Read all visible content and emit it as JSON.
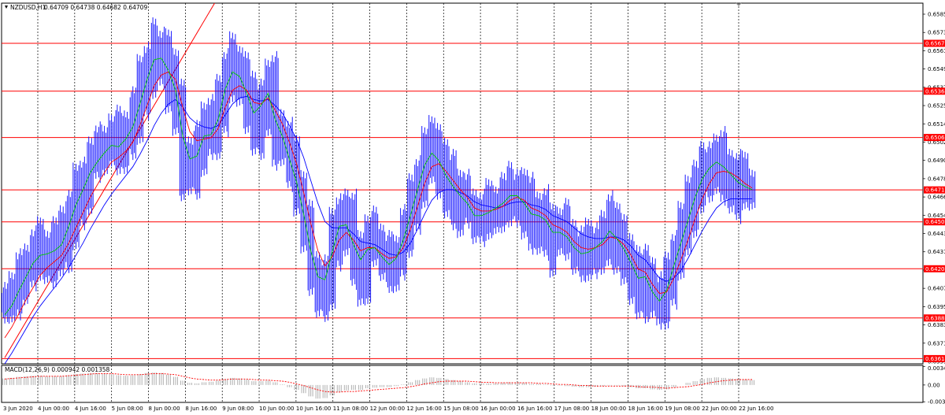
{
  "header": {
    "symbol": "NZDUSD,H1",
    "ohlc": "0.64709 0.64738 0.64682 0.64709"
  },
  "macd_header": {
    "label": "MACD(12,26,9) 0.000942 0.001358"
  },
  "colors": {
    "background": "#ffffff",
    "price_bars": "#0000ff",
    "ma_fast": "#00c800",
    "ma_mid": "#ff0000",
    "ma_slow": "#0000ff",
    "level_line": "#ff0000",
    "trend_line": "#ff0000",
    "grid": "#000000"
  },
  "chart_data": [
    {
      "type": "line",
      "subtype": "candlestick-bars-with-moving-averages",
      "symbol": "NZDUSD",
      "timeframe": "H1",
      "y_ticks": [
        "0.65855",
        "0.65735",
        "0.65615",
        "0.65495",
        "0.65375",
        "0.65255",
        "0.65140",
        "0.65020",
        "0.64900",
        "0.64780",
        "0.64665",
        "0.64545",
        "0.64430",
        "0.64310",
        "0.64190",
        "0.64070",
        "0.63950",
        "0.63830",
        "0.63710",
        "0.63590"
      ],
      "ylim": [
        0.6358,
        0.6594
      ],
      "x_ticks": [
        "3 Jun 2020",
        "4 Jun 00:00",
        "4 Jun 16:00",
        "5 Jun 08:00",
        "8 Jun 00:00",
        "8 Jun 16:00",
        "9 Jun 08:00",
        "10 Jun 00:00",
        "10 Jun 16:00",
        "11 Jun 08:00",
        "12 Jun 00:00",
        "12 Jun 16:00",
        "15 Jun 08:00",
        "16 Jun 00:00",
        "16 Jun 16:00",
        "17 Jun 08:00",
        "18 Jun 00:00",
        "18 Jun 16:00",
        "19 Jun 08:00",
        "22 Jun 00:00",
        "22 Jun 16:00"
      ],
      "horizontal_levels": [
        "0.65677",
        "0.65364",
        "0.65061",
        "0.64718",
        "0.64509",
        "0.64202",
        "0.63880",
        "0.63614"
      ],
      "series": [
        {
          "role": "close",
          "values": [
            0.6398,
            0.6402,
            0.6412,
            0.6423,
            0.643,
            0.6432,
            0.6428,
            0.6435,
            0.644,
            0.6455,
            0.647,
            0.648,
            0.649,
            0.6495,
            0.65,
            0.6505,
            0.6498,
            0.651,
            0.652,
            0.6538,
            0.6552,
            0.6565,
            0.656,
            0.6545,
            0.653,
            0.649,
            0.648,
            0.6495,
            0.6515,
            0.6508,
            0.6525,
            0.6548,
            0.6555,
            0.6545,
            0.653,
            0.6515,
            0.653,
            0.654,
            0.651,
            0.65,
            0.6485,
            0.647,
            0.6445,
            0.642,
            0.6405,
            0.6412,
            0.644,
            0.6455,
            0.645,
            0.643,
            0.642,
            0.6438,
            0.6435,
            0.6425,
            0.642,
            0.643,
            0.6445,
            0.6462,
            0.648,
            0.6495,
            0.65,
            0.6488,
            0.6475,
            0.647,
            0.6465,
            0.646,
            0.645,
            0.6455,
            0.6458,
            0.6462,
            0.6465,
            0.647,
            0.6468,
            0.646,
            0.6452,
            0.6455,
            0.645,
            0.644,
            0.6445,
            0.644,
            0.643,
            0.6428,
            0.6432,
            0.6435,
            0.644,
            0.6448,
            0.6438,
            0.643,
            0.642,
            0.641,
            0.6415,
            0.64,
            0.6395,
            0.641,
            0.643,
            0.6445,
            0.646,
            0.6475,
            0.6485,
            0.649,
            0.6492,
            0.6485,
            0.648,
            0.6475,
            0.6472,
            0.6471
          ]
        },
        {
          "role": "ma_fast",
          "values": [
            0.639,
            0.6396,
            0.6406,
            0.6415,
            0.6424,
            0.6429,
            0.643,
            0.6432,
            0.6436,
            0.6448,
            0.6462,
            0.6472,
            0.6483,
            0.649,
            0.6496,
            0.6501,
            0.65,
            0.6505,
            0.6513,
            0.6528,
            0.6544,
            0.6557,
            0.6558,
            0.655,
            0.6537,
            0.6507,
            0.6492,
            0.6494,
            0.6507,
            0.6508,
            0.6518,
            0.6538,
            0.6549,
            0.6546,
            0.6535,
            0.6522,
            0.6527,
            0.6535,
            0.6518,
            0.6507,
            0.6492,
            0.6477,
            0.6456,
            0.6432,
            0.6415,
            0.6413,
            0.6431,
            0.6448,
            0.6449,
            0.6436,
            0.6426,
            0.6433,
            0.6434,
            0.6428,
            0.6423,
            0.6427,
            0.6439,
            0.6455,
            0.6472,
            0.6488,
            0.6496,
            0.6491,
            0.6481,
            0.6474,
            0.6468,
            0.6463,
            0.6455,
            0.6455,
            0.6457,
            0.646,
            0.6463,
            0.6468,
            0.6468,
            0.6463,
            0.6456,
            0.6455,
            0.6452,
            0.6444,
            0.6444,
            0.6441,
            0.6434,
            0.643,
            0.6431,
            0.6434,
            0.6438,
            0.6445,
            0.644,
            0.6433,
            0.6424,
            0.6414,
            0.6415,
            0.6405,
            0.6399,
            0.6406,
            0.6422,
            0.6437,
            0.6452,
            0.6467,
            0.6479,
            0.6486,
            0.649,
            0.6487,
            0.6482,
            0.6477,
            0.6474,
            0.6472
          ]
        },
        {
          "role": "ma_mid",
          "values": [
            0.6375,
            0.6382,
            0.6391,
            0.64,
            0.6408,
            0.6416,
            0.6421,
            0.6425,
            0.6429,
            0.6437,
            0.6447,
            0.6457,
            0.6467,
            0.6475,
            0.6483,
            0.649,
            0.6493,
            0.6497,
            0.6503,
            0.6514,
            0.6527,
            0.654,
            0.6547,
            0.6549,
            0.6544,
            0.6526,
            0.651,
            0.6504,
            0.6505,
            0.6506,
            0.6512,
            0.6526,
            0.6537,
            0.654,
            0.6537,
            0.6529,
            0.6528,
            0.6532,
            0.6524,
            0.6515,
            0.6503,
            0.6489,
            0.647,
            0.645,
            0.6432,
            0.6422,
            0.6428,
            0.6439,
            0.6444,
            0.6439,
            0.6432,
            0.6434,
            0.6434,
            0.643,
            0.6427,
            0.6428,
            0.6434,
            0.6446,
            0.6461,
            0.6476,
            0.6487,
            0.6489,
            0.6484,
            0.6478,
            0.6472,
            0.6467,
            0.646,
            0.6458,
            0.6458,
            0.6459,
            0.6461,
            0.6465,
            0.6467,
            0.6465,
            0.646,
            0.6458,
            0.6455,
            0.6449,
            0.6447,
            0.6444,
            0.6438,
            0.6434,
            0.6433,
            0.6434,
            0.6436,
            0.6441,
            0.644,
            0.6436,
            0.6429,
            0.642,
            0.6418,
            0.641,
            0.6404,
            0.6405,
            0.6414,
            0.6426,
            0.6439,
            0.6453,
            0.6466,
            0.6476,
            0.6483,
            0.6484,
            0.6483,
            0.648,
            0.6476,
            0.6473
          ]
        },
        {
          "role": "ma_slow",
          "values": [
            0.6358,
            0.6365,
            0.6373,
            0.6381,
            0.6389,
            0.6396,
            0.6402,
            0.6408,
            0.6414,
            0.6421,
            0.6429,
            0.6437,
            0.6446,
            0.6454,
            0.6462,
            0.6469,
            0.6475,
            0.6481,
            0.6487,
            0.6495,
            0.6504,
            0.6514,
            0.6522,
            0.6528,
            0.6531,
            0.6526,
            0.6519,
            0.6515,
            0.6513,
            0.6512,
            0.6514,
            0.6521,
            0.6528,
            0.6532,
            0.6533,
            0.6531,
            0.653,
            0.6531,
            0.6527,
            0.6522,
            0.6514,
            0.6505,
            0.6493,
            0.6478,
            0.6463,
            0.6451,
            0.6447,
            0.6447,
            0.6447,
            0.6443,
            0.6438,
            0.6437,
            0.6436,
            0.6433,
            0.643,
            0.6429,
            0.6431,
            0.6437,
            0.6446,
            0.6456,
            0.6465,
            0.647,
            0.6472,
            0.6472,
            0.647,
            0.6468,
            0.6464,
            0.6462,
            0.6461,
            0.646,
            0.6461,
            0.6463,
            0.6464,
            0.6464,
            0.6462,
            0.6461,
            0.6459,
            0.6455,
            0.6453,
            0.6451,
            0.6447,
            0.6443,
            0.6441,
            0.644,
            0.644,
            0.6441,
            0.6441,
            0.6439,
            0.6435,
            0.6429,
            0.6426,
            0.642,
            0.6414,
            0.6412,
            0.6414,
            0.6419,
            0.6427,
            0.6436,
            0.6445,
            0.6453,
            0.646,
            0.6464,
            0.6466,
            0.6466,
            0.6466,
            0.6466
          ]
        }
      ],
      "trend_line": {
        "from": [
          0,
          0.6362
        ],
        "to": [
          30,
          0.6598
        ]
      }
    },
    {
      "type": "bar",
      "subtype": "macd-histogram-with-signal",
      "name": "MACD(12,26,9)",
      "y_ticks": [
        "0.003415",
        "0.00",
        "-0.00308"
      ],
      "ylim": [
        -0.0032,
        0.0036
      ],
      "histogram": [
        0.0012,
        0.0013,
        0.0015,
        0.0016,
        0.0017,
        0.0017,
        0.0016,
        0.0016,
        0.0016,
        0.0018,
        0.002,
        0.0021,
        0.0022,
        0.0022,
        0.0021,
        0.002,
        0.0018,
        0.0017,
        0.0018,
        0.002,
        0.0022,
        0.0023,
        0.0022,
        0.0019,
        0.0015,
        0.0008,
        0.0004,
        0.0003,
        0.0005,
        0.0006,
        0.0008,
        0.0011,
        0.0013,
        0.0012,
        0.001,
        0.0007,
        0.0007,
        0.0008,
        0.0005,
        0.0001,
        -0.0004,
        -0.0009,
        -0.0015,
        -0.0021,
        -0.0025,
        -0.0024,
        -0.0019,
        -0.0013,
        -0.001,
        -0.0009,
        -0.0009,
        -0.0006,
        -0.0005,
        -0.0004,
        -0.0004,
        -0.0002,
        0.0001,
        0.0005,
        0.0009,
        0.0012,
        0.0014,
        0.0013,
        0.0011,
        0.0009,
        0.0007,
        0.0005,
        0.0003,
        0.0003,
        0.0003,
        0.0003,
        0.0004,
        0.0005,
        0.0005,
        0.0004,
        0.0002,
        0.0002,
        0.0001,
        -0.0001,
        -0.0001,
        -0.0002,
        -0.0003,
        -0.0004,
        -0.0004,
        -0.0003,
        -0.0002,
        -0.0001,
        -0.0001,
        -0.0002,
        -0.0004,
        -0.0006,
        -0.0006,
        -0.0008,
        -0.0009,
        -0.0008,
        -0.0004,
        0.0,
        0.0004,
        0.0007,
        0.0011,
        0.0013,
        0.0014,
        0.0013,
        0.0012,
        0.0011,
        0.001,
        0.0009
      ],
      "signal": [
        0.0011,
        0.0012,
        0.0013,
        0.0014,
        0.0015,
        0.0016,
        0.0016,
        0.0016,
        0.0016,
        0.0017,
        0.0018,
        0.0019,
        0.002,
        0.0021,
        0.0021,
        0.0021,
        0.002,
        0.0019,
        0.0019,
        0.0019,
        0.002,
        0.0021,
        0.0021,
        0.002,
        0.0019,
        0.0016,
        0.0013,
        0.0011,
        0.001,
        0.0009,
        0.0009,
        0.001,
        0.0011,
        0.0011,
        0.0011,
        0.001,
        0.0009,
        0.0009,
        0.0008,
        0.0007,
        0.0005,
        0.0002,
        -0.0001,
        -0.0005,
        -0.0009,
        -0.0012,
        -0.0013,
        -0.0013,
        -0.0012,
        -0.0012,
        -0.0011,
        -0.001,
        -0.0009,
        -0.0008,
        -0.0007,
        -0.0006,
        -0.0005,
        -0.0003,
        -0.0001,
        0.0002,
        0.0004,
        0.0006,
        0.0007,
        0.0007,
        0.0007,
        0.0007,
        0.0006,
        0.0005,
        0.0005,
        0.0004,
        0.0004,
        0.0004,
        0.0004,
        0.0004,
        0.0004,
        0.0003,
        0.0003,
        0.0002,
        0.0001,
        0.0001,
        0.0,
        -0.0001,
        -0.0001,
        -0.0002,
        -0.0002,
        -0.0002,
        -0.0002,
        -0.0002,
        -0.0002,
        -0.0003,
        -0.0004,
        -0.0004,
        -0.0005,
        -0.0006,
        -0.0005,
        -0.0004,
        -0.0003,
        -0.0001,
        0.0001,
        0.0004,
        0.0006,
        0.0008,
        0.0009,
        0.001,
        0.001,
        0.001
      ]
    }
  ]
}
